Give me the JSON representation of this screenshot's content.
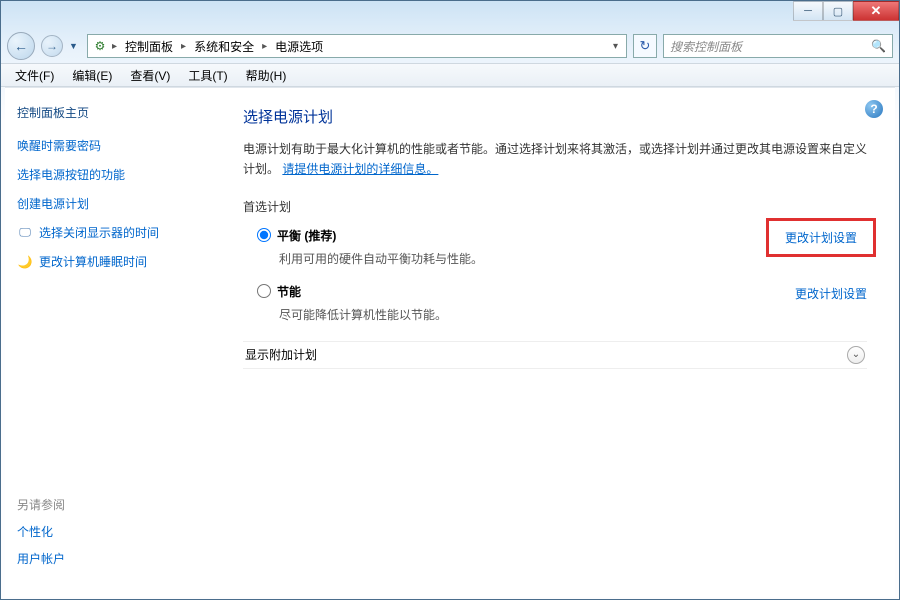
{
  "breadcrumb": {
    "item1": "控制面板",
    "item2": "系统和安全",
    "item3": "电源选项"
  },
  "search": {
    "placeholder": "搜索控制面板"
  },
  "menubar": {
    "file": "文件(F)",
    "edit": "编辑(E)",
    "view": "查看(V)",
    "tools": "工具(T)",
    "help": "帮助(H)"
  },
  "sidebar": {
    "home": "控制面板主页",
    "links": {
      "wake_password": "唤醒时需要密码",
      "button_action": "选择电源按钮的功能",
      "create_plan": "创建电源计划",
      "display_off": "选择关闭显示器的时间",
      "sleep_time": "更改计算机睡眠时间"
    },
    "see_also_hdr": "另请参阅",
    "see_also": {
      "personalize": "个性化",
      "accounts": "用户帐户"
    }
  },
  "content": {
    "title": "选择电源计划",
    "desc_a": "电源计划有助于最大化计算机的性能或者节能。通过选择计划来将其激活，或选择计划并通过更改其电源设置来自定义计划。",
    "desc_link": "请提供电源计划的详细信息。",
    "preferred_hdr": "首选计划",
    "plan_balanced": {
      "name": "平衡 (推荐)",
      "desc": "利用可用的硬件自动平衡功耗与性能。",
      "change": "更改计划设置"
    },
    "plan_saver": {
      "name": "节能",
      "desc": "尽可能降低计算机性能以节能。",
      "change": "更改计划设置"
    },
    "show_additional": "显示附加计划"
  }
}
